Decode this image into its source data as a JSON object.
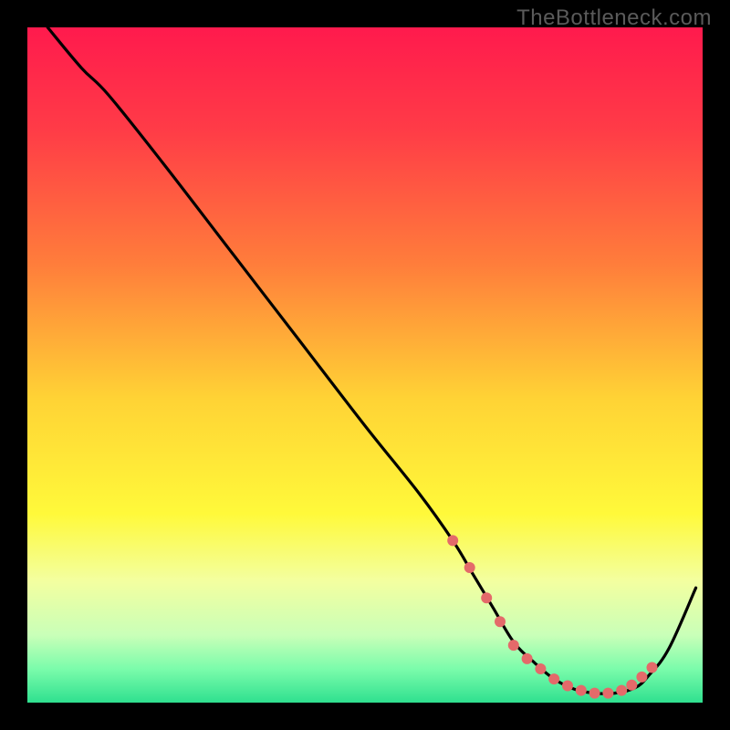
{
  "watermark": "TheBottleneck.com",
  "chart_data": {
    "type": "line",
    "title": "",
    "xlabel": "",
    "ylabel": "",
    "xlim": [
      0,
      100
    ],
    "ylim": [
      0,
      100
    ],
    "background_gradient": {
      "orientation": "vertical",
      "stops": [
        {
          "offset": 0.0,
          "color": "#ff1a4d"
        },
        {
          "offset": 0.15,
          "color": "#ff3b47"
        },
        {
          "offset": 0.35,
          "color": "#ff7d3b"
        },
        {
          "offset": 0.55,
          "color": "#ffd335"
        },
        {
          "offset": 0.72,
          "color": "#fff93a"
        },
        {
          "offset": 0.82,
          "color": "#f3ffa0"
        },
        {
          "offset": 0.9,
          "color": "#c9ffb8"
        },
        {
          "offset": 0.95,
          "color": "#7bfcab"
        },
        {
          "offset": 1.0,
          "color": "#2fe08f"
        }
      ]
    },
    "series": [
      {
        "name": "bottleneck-curve",
        "color": "#000000",
        "x": [
          3,
          8,
          12,
          20,
          30,
          40,
          50,
          58,
          63,
          66,
          69,
          72,
          75,
          78,
          81,
          84,
          87,
          90,
          92,
          95,
          99
        ],
        "y": [
          100,
          94,
          90,
          80,
          67,
          54,
          41,
          31,
          24,
          19,
          14,
          9,
          6,
          3.5,
          2,
          1.4,
          1.4,
          2.2,
          4,
          8,
          17
        ]
      }
    ],
    "markers": {
      "name": "highlight-dots",
      "color": "#e46a6a",
      "radius": 6,
      "x": [
        63,
        65.5,
        68,
        70,
        72,
        74,
        76,
        78,
        80,
        82,
        84,
        86,
        88,
        89.5,
        91,
        92.5
      ],
      "y": [
        24,
        20,
        15.5,
        12,
        8.5,
        6.5,
        5,
        3.5,
        2.5,
        1.8,
        1.4,
        1.4,
        1.8,
        2.6,
        3.8,
        5.2
      ]
    }
  }
}
